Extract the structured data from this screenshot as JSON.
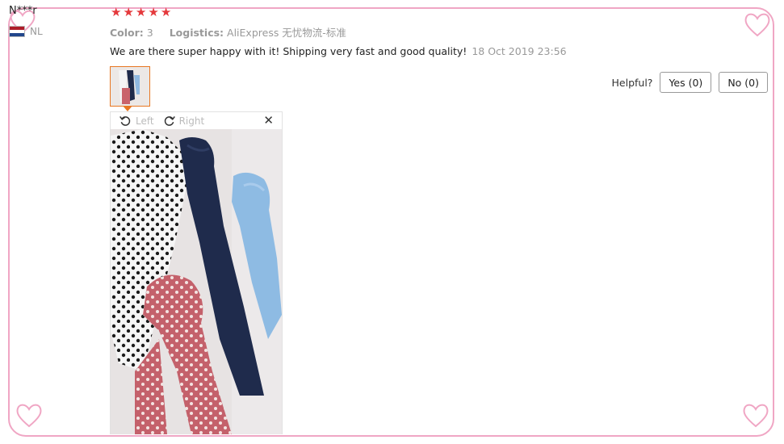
{
  "review": {
    "reviewer": "N***r",
    "country_code": "NL",
    "flag_colors": [
      "#ae1c28",
      "#ffffff",
      "#21468b"
    ],
    "rating": 5,
    "star_glyphs": [
      "★",
      "★",
      "★",
      "★",
      "★"
    ],
    "color_label": "Color:",
    "color_value": "3",
    "logistics_label": "Logistics:",
    "logistics_value": "AliExpress 无忧物流-标准",
    "text": "We are there super happy with it! Shipping very fast and good quality!",
    "date": "18 Oct 2019 23:56"
  },
  "helpful": {
    "label": "Helpful?",
    "yes": "Yes (0)",
    "no": "No (0)"
  },
  "viewer": {
    "left_label": "Left",
    "right_label": "Right",
    "close_glyph": "✕"
  },
  "colors": {
    "star": "#e4393c",
    "frame": "#f0a6c4",
    "thumb_border": "#e87722"
  }
}
